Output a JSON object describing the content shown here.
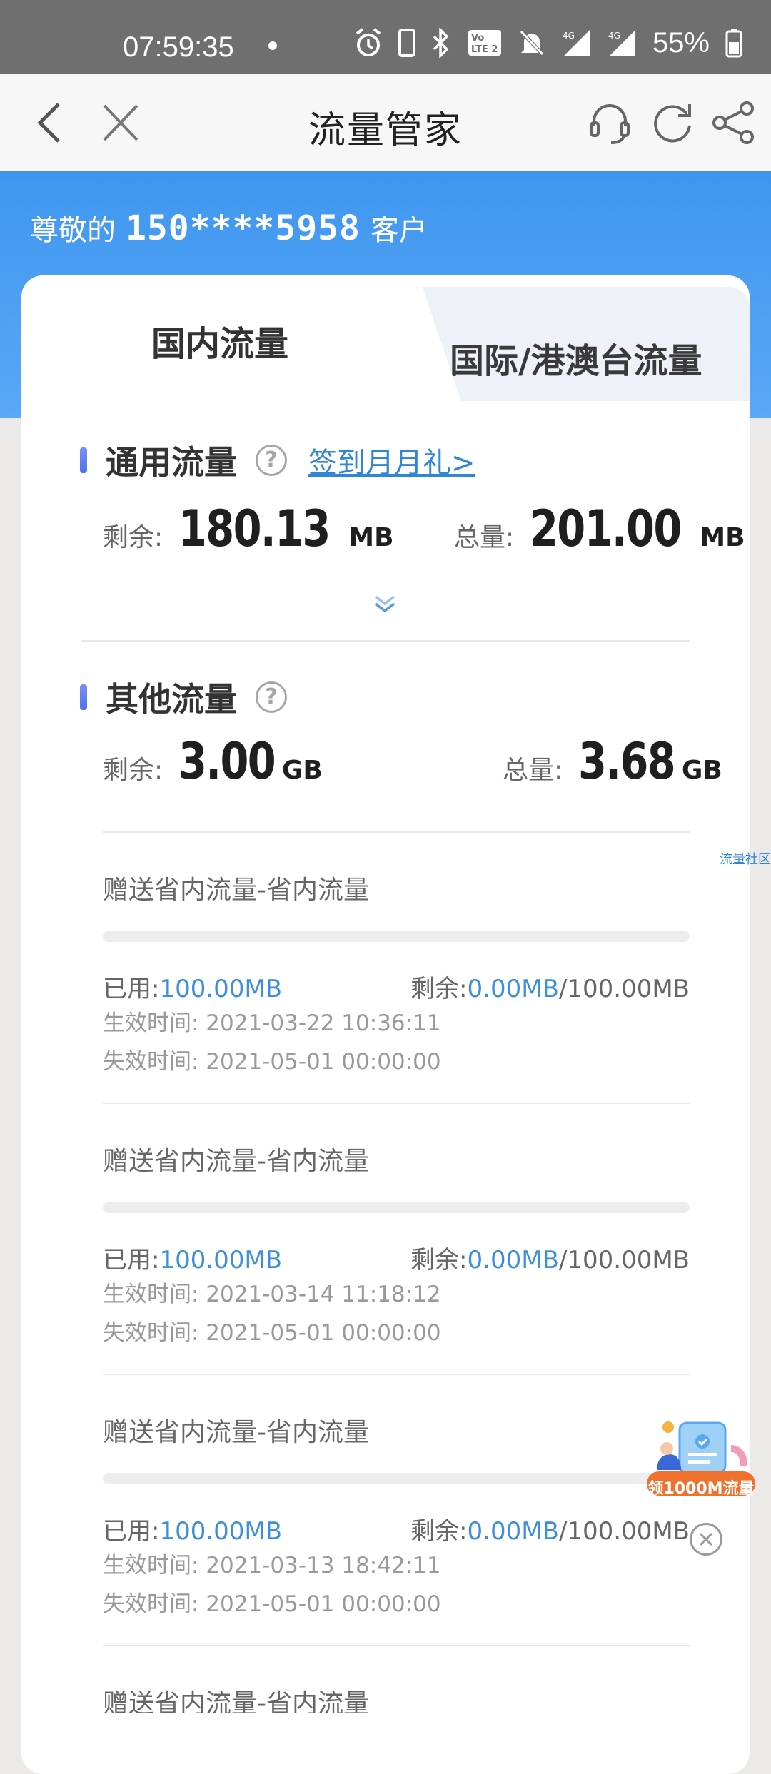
{
  "status_bar": {
    "time": "07:59:35",
    "battery": "55%"
  },
  "nav": {
    "title": "流量管家"
  },
  "greeting": {
    "prefix": "尊敬的",
    "phone": "150****5958",
    "suffix": "客户"
  },
  "tabs": {
    "active": "国内流量",
    "inactive": "国际/港澳台流量"
  },
  "general": {
    "title": "通用流量",
    "sign_link": "签到月月礼>",
    "remain_label": "剩余:",
    "remain_value": "180.13",
    "remain_unit": "MB",
    "total_label": "总量:",
    "total_value": "201.00",
    "total_unit": "MB"
  },
  "other": {
    "title": "其他流量",
    "remain_label": "剩余:",
    "remain_value": "3.00",
    "remain_unit": "GB",
    "total_label": "总量:",
    "total_value": "3.68",
    "total_unit": "GB"
  },
  "items": [
    {
      "title": "赠送省内流量-省内流量",
      "used_label": "已用:",
      "used": "100.00MB",
      "remain_label": "剩余:",
      "remain": "0.00MB",
      "total": "/100.00MB",
      "start": "生效时间:  2021-03-22 10:36:11",
      "end": "失效时间:  2021-05-01 00:00:00",
      "remain_fraction": 0
    },
    {
      "title": "赠送省内流量-省内流量",
      "used_label": "已用:",
      "used": "100.00MB",
      "remain_label": "剩余:",
      "remain": "0.00MB",
      "total": "/100.00MB",
      "start": "生效时间:  2021-03-14 11:18:12",
      "end": "失效时间:  2021-05-01 00:00:00",
      "remain_fraction": 0
    },
    {
      "title": "赠送省内流量-省内流量",
      "used_label": "已用:",
      "used": "100.00MB",
      "remain_label": "剩余:",
      "remain": "0.00MB",
      "total": "/100.00MB",
      "start": "生效时间:  2021-03-13 18:42:11",
      "end": "失效时间:  2021-05-01 00:00:00",
      "remain_fraction": 0
    },
    {
      "title": "赠送省内流量-省内流量"
    }
  ],
  "side_tag": "流量社区",
  "promo": {
    "label": "领1000M流量"
  },
  "colors": {
    "banner_blue": "#4a9ff2",
    "link_blue": "#2f86d6",
    "value_blue": "#3d8fdc"
  }
}
